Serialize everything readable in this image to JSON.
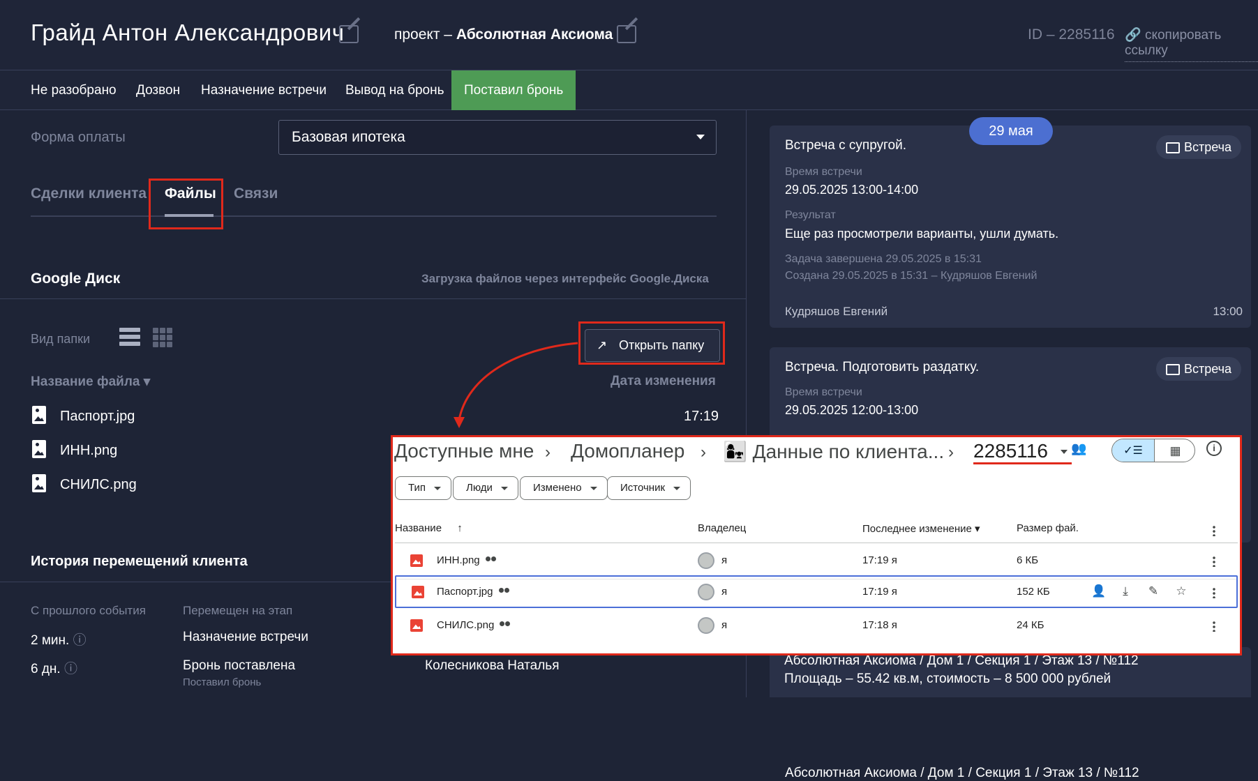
{
  "header": {
    "client_name": "Грайд Антон Александрович",
    "project_prefix": "проект – ",
    "project_name": "Абсолютная Аксиома",
    "id_text": "ID – 2285116",
    "copy_link": "скопировать ссылку"
  },
  "stages": [
    "Не разобрано",
    "Дозвон",
    "Назначение встречи",
    "Вывод на бронь",
    "Поставил бронь"
  ],
  "left": {
    "payment_label": "Форма оплаты",
    "payment_value": "Базовая ипотека",
    "tabs": [
      "Сделки клиента",
      "Файлы",
      "Связи"
    ],
    "google_title": "Google Диск",
    "google_hint": "Загрузка файлов через интерфейс Google.Диска",
    "folder_view_label": "Вид папки",
    "open_folder": "Открыть папку",
    "col_name": "Название файла",
    "col_date": "Дата изменения",
    "files": [
      {
        "name": "Паспорт.jpg",
        "date": "17:19"
      },
      {
        "name": "ИНН.png",
        "date": ""
      },
      {
        "name": "СНИЛС.png",
        "date": ""
      }
    ],
    "history_title": "История перемещений клиента",
    "history_cols": [
      "С прошлого события",
      "Перемещен на этап"
    ],
    "history_rows": [
      {
        "since": "2 мин.",
        "stage": "Назначение встречи",
        "sub": "",
        "who": ""
      },
      {
        "since": "6 дн.",
        "stage": "Бронь поставлена",
        "sub": "Поставил бронь",
        "who": "Колесникова Наталья"
      }
    ]
  },
  "right": {
    "date_pill": "29 мая",
    "cards": [
      {
        "title": "Встреча с супругой.",
        "badge": "Встреча",
        "time_label": "Время встречи",
        "time_value": "29.05.2025 13:00-14:00",
        "result_label": "Результат",
        "result_value": "Еще раз просмотрели варианты, ушли думать.",
        "done": "Задача завершена 29.05.2025 в 15:31",
        "created": "Создана 29.05.2025 в 15:31 – Кудряшов Евгений",
        "author": "Кудряшов Евгений",
        "time": "13:00"
      },
      {
        "title": "Встреча. Подготовить раздатку.",
        "badge": "Встреча",
        "time_label": "Время встречи",
        "time_value": "29.05.2025 12:00-13:00"
      }
    ],
    "bottom_line1": "Абсолютная Аксиома / Дом 1 / Секция 1 / Этаж 13 / №112",
    "bottom_line2": "Площадь – 55.42 кв.м, стоимость – 8 500 000 рублей"
  },
  "gdrive": {
    "crumbs": [
      "Доступные мне",
      "Домопланер",
      "👩‍👧 Данные по клиента...",
      "2285116"
    ],
    "chips": [
      "Тип",
      "Люди",
      "Изменено",
      "Источник"
    ],
    "cols": [
      "Название",
      "Владелец",
      "Последнее изменение",
      "Размер фай."
    ],
    "rows": [
      {
        "name": "ИНН.png",
        "owner": "я",
        "modified": "17:19 я",
        "size": "6 КБ"
      },
      {
        "name": "Паспорт.jpg",
        "owner": "я",
        "modified": "17:19 я",
        "size": "152 КБ"
      },
      {
        "name": "СНИЛС.png",
        "owner": "я",
        "modified": "17:18 я",
        "size": "24 КБ"
      }
    ]
  },
  "colors": {
    "accent_green": "#4e9b55",
    "highlight_red": "#e0291b",
    "pill_blue": "#4c6fd1"
  }
}
